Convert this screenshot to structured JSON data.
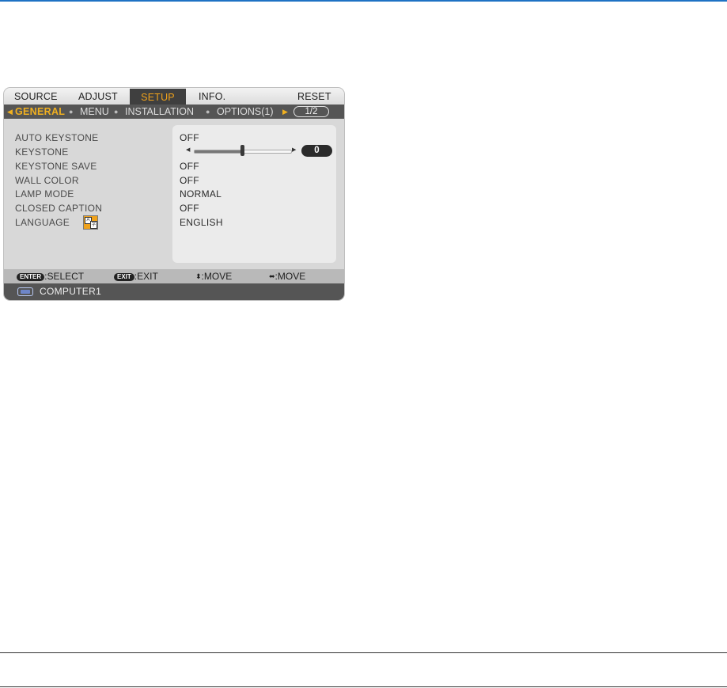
{
  "menu": {
    "tabs": [
      {
        "label": "SOURCE",
        "active": false
      },
      {
        "label": "ADJUST",
        "active": false
      },
      {
        "label": "SETUP",
        "active": true
      },
      {
        "label": "INFO.",
        "active": false
      },
      {
        "label": "RESET",
        "active": false
      }
    ],
    "subtabs": [
      "GENERAL",
      "MENU",
      "INSTALLATION",
      "OPTIONS(1)"
    ],
    "active_subtab": "GENERAL",
    "page_indicator": "1/2"
  },
  "settings": [
    {
      "label": "AUTO KEYSTONE",
      "value": "OFF"
    },
    {
      "label": "KEYSTONE",
      "value": "0",
      "type": "slider",
      "slider_level": 0.5
    },
    {
      "label": "KEYSTONE SAVE",
      "value": "OFF"
    },
    {
      "label": "WALL COLOR",
      "value": "OFF"
    },
    {
      "label": "LAMP MODE",
      "value": "NORMAL"
    },
    {
      "label": "CLOSED CAPTION",
      "value": "OFF"
    },
    {
      "label": "LANGUAGE",
      "value": "ENGLISH",
      "icon": "language-icon"
    }
  ],
  "help": [
    {
      "key": "ENTER",
      "label": ":SELECT"
    },
    {
      "key": "EXIT",
      "label": ":EXIT"
    },
    {
      "key": "up-down-arrows-icon",
      "label": ":MOVE"
    },
    {
      "key": "left-right-arrows-icon",
      "label": ":MOVE"
    }
  ],
  "status": {
    "icon": "computer-input-icon",
    "source": "COMPUTER1"
  },
  "colors": {
    "accent": "#f0a21b",
    "rule": "#1e72c4"
  }
}
